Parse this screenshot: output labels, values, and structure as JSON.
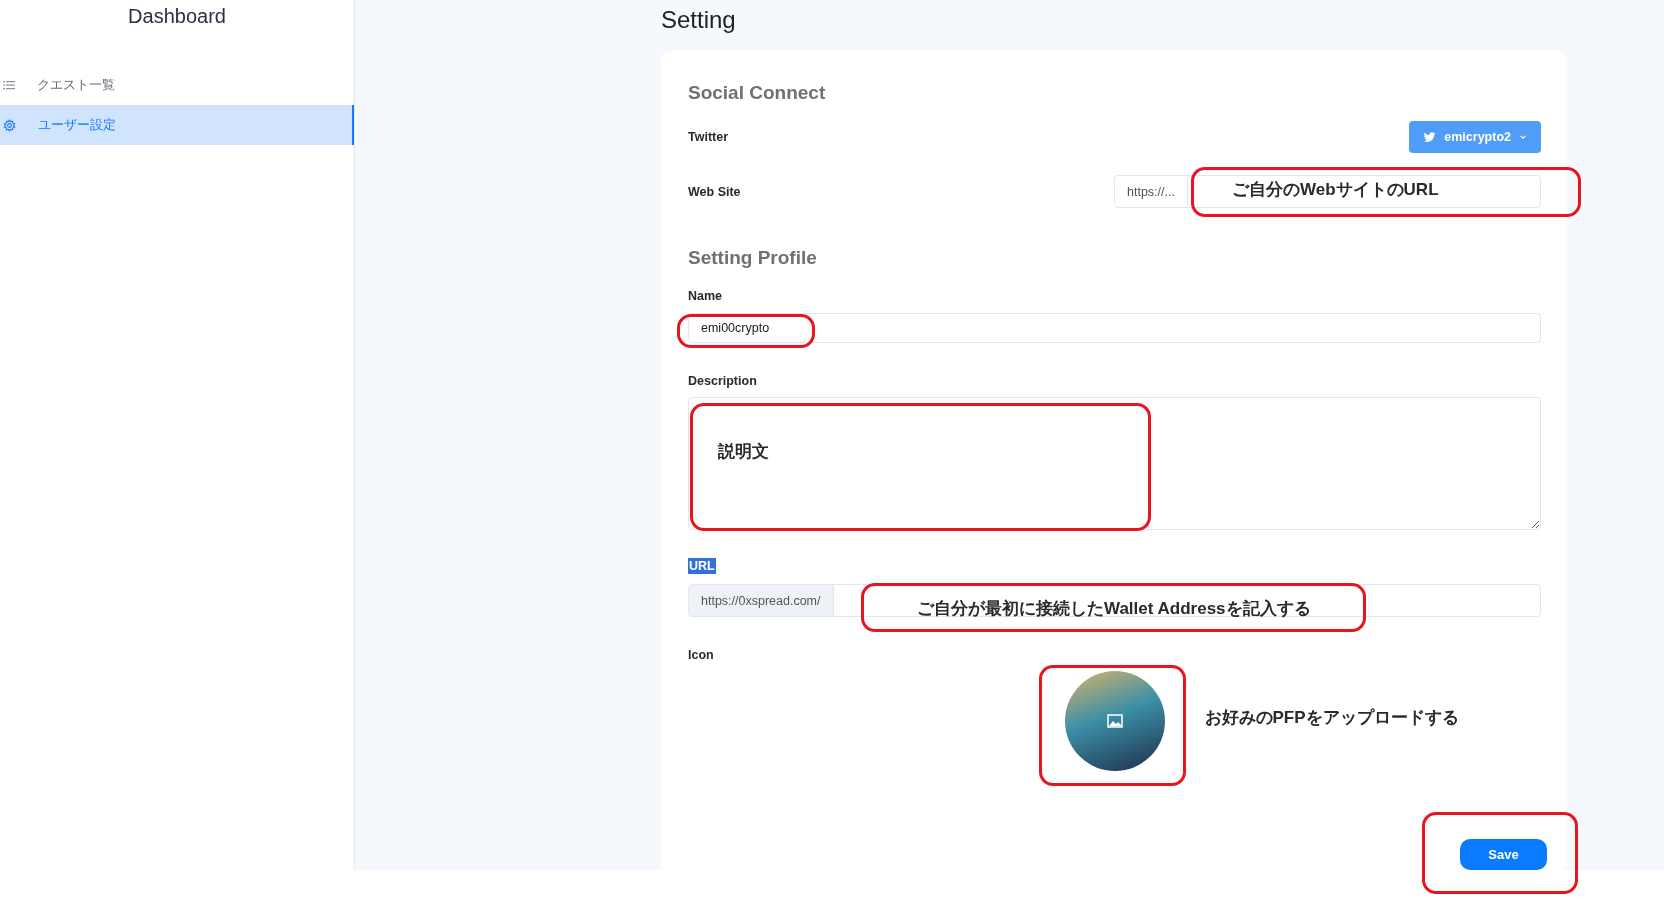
{
  "sidebar": {
    "title": "Dashboard",
    "items": [
      {
        "label": "クエスト一覧",
        "selected": false
      },
      {
        "label": "ユーザー設定",
        "selected": true
      }
    ]
  },
  "page_title": "Setting",
  "social_connect": {
    "heading": "Social Connect",
    "twitter": {
      "label": "Twitter",
      "account": "emicrypto2"
    },
    "website": {
      "label": "Web Site",
      "prefix": "https://...",
      "annotation": {
        "outlined": true,
        "text": "ご自分のWebサイトのURL"
      }
    }
  },
  "profile": {
    "heading": "Setting Profile",
    "name": {
      "label": "Name",
      "value": "emi00crypto",
      "annotation": {
        "outlined": true
      }
    },
    "description": {
      "label": "Description",
      "annotation": {
        "outlined": true,
        "text": "説明文"
      }
    },
    "url": {
      "label": "URL",
      "highlighted": true,
      "prefix": "https://0xspread.com/",
      "annotation": {
        "outlined": true,
        "text": "ご自分が最初に接続したWallet Addressを記入する"
      }
    },
    "icon": {
      "label": "Icon",
      "annotation": {
        "outlined": true,
        "text": "お好みのPFPをアップロードする"
      }
    }
  },
  "save_button": {
    "label": "Save",
    "annotation": {
      "outlined": true
    }
  }
}
